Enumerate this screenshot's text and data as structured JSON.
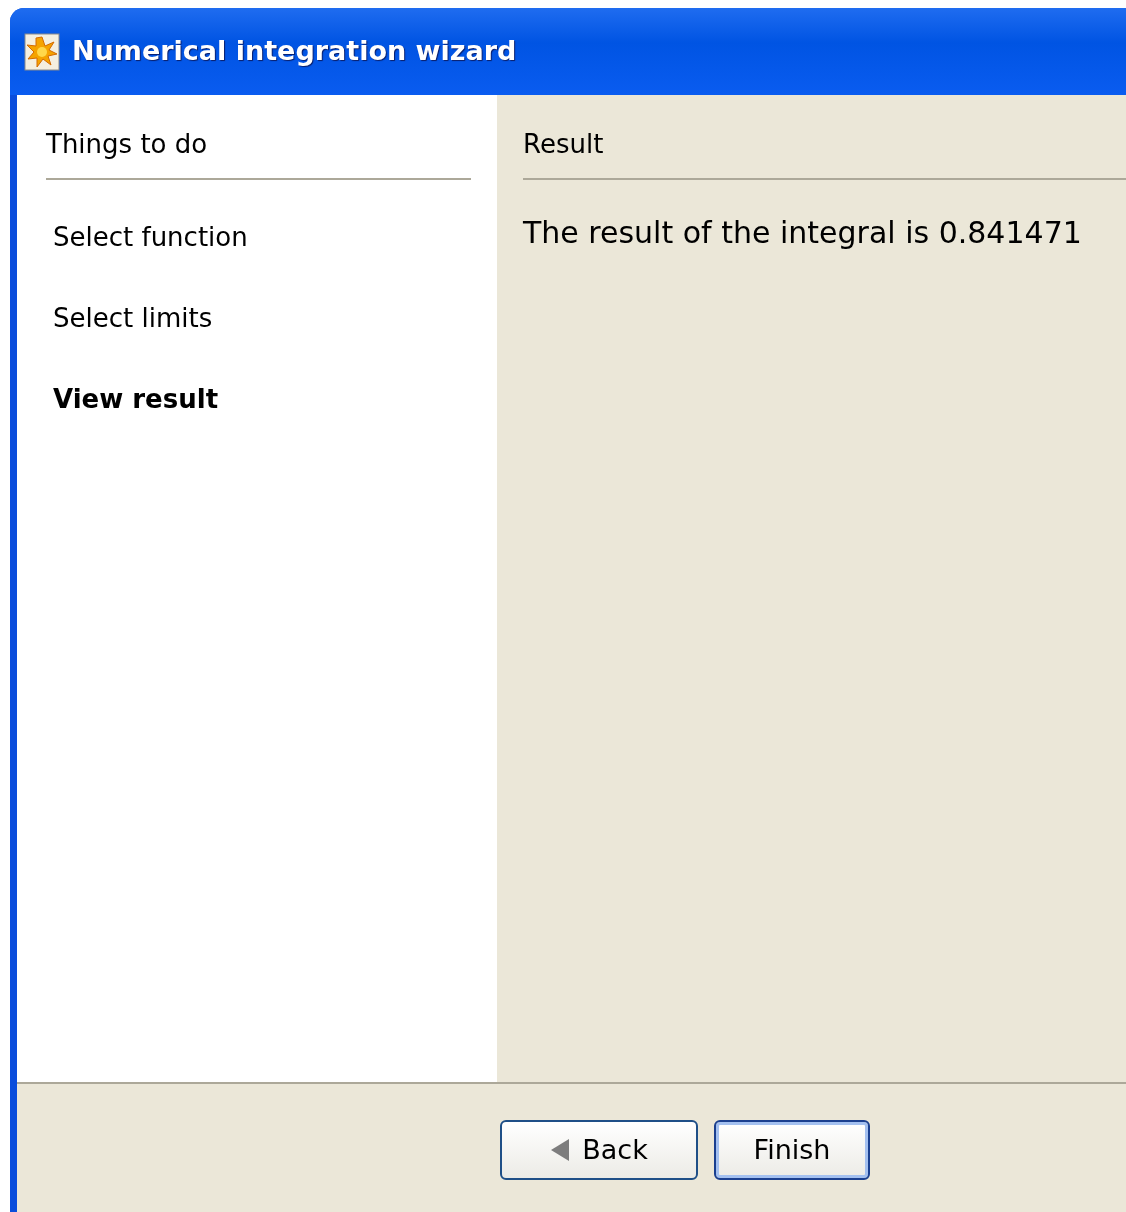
{
  "window": {
    "title": "Numerical integration wizard"
  },
  "steps_panel": {
    "heading": "Things to do",
    "steps": [
      {
        "label": "Select function",
        "selected": false
      },
      {
        "label": "Select limits",
        "selected": false
      },
      {
        "label": "View result",
        "selected": true
      }
    ]
  },
  "content": {
    "heading": "Result",
    "message": "The result of the integral is 0.841471"
  },
  "buttons": [
    {
      "label": "Back",
      "kind": "back",
      "default": false
    },
    {
      "label": "Finish",
      "kind": "finish",
      "default": true
    }
  ]
}
